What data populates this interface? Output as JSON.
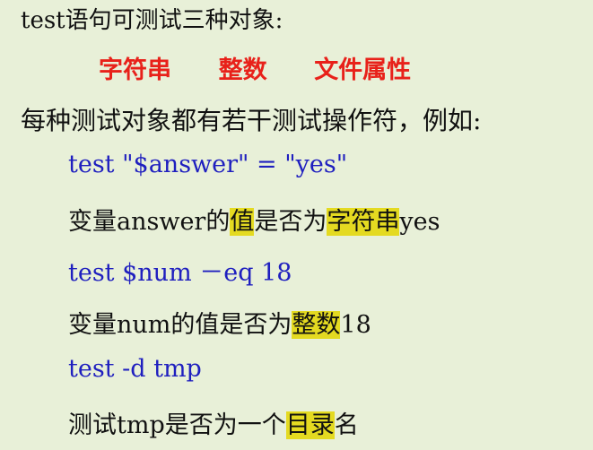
{
  "intro": "test语句可测试三种对象:",
  "objects": [
    "字符串",
    "整数",
    "文件属性"
  ],
  "operators_intro": "每种测试对象都有若干测试操作符，例如:",
  "examples": [
    {
      "command": "test \"$answer\" = \"yes\"",
      "desc_parts": [
        {
          "text": "变量answer的",
          "hl": false
        },
        {
          "text": "值",
          "hl": true
        },
        {
          "text": "是否为",
          "hl": false
        },
        {
          "text": "字符串",
          "hl": true
        },
        {
          "text": "yes",
          "hl": false
        }
      ]
    },
    {
      "command": "test $num －eq 18",
      "desc_parts": [
        {
          "text": "变量num的值是否为",
          "hl": false
        },
        {
          "text": "整数",
          "hl": true
        },
        {
          "text": "18",
          "hl": false
        }
      ]
    },
    {
      "command": "test -d tmp",
      "desc_parts": [
        {
          "text": "测试tmp是否为一个",
          "hl": false
        },
        {
          "text": "目录",
          "hl": true
        },
        {
          "text": "名",
          "hl": false
        }
      ]
    }
  ],
  "colors": {
    "background": "#e8f0d8",
    "text": "#111111",
    "object_red": "#e8211a",
    "command_blue": "#1f1fbf",
    "highlight": "#e4da21"
  }
}
